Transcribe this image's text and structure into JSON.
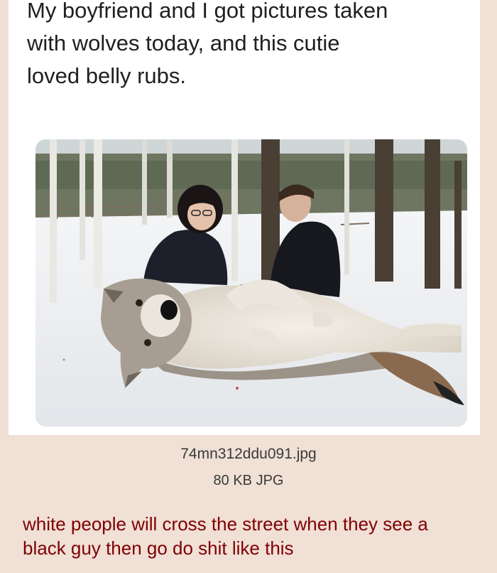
{
  "tweet": {
    "text": "My boyfriend and I got pictures taken\nwith wolves today, and this cutie\nloved belly rubs."
  },
  "attachment": {
    "filename": "74mn312ddu091.jpg",
    "size_type": "80 KB JPG"
  },
  "comment": {
    "text": "white people will cross the street when they see a\nblack guy then go do shit like this"
  },
  "colors": {
    "page_background": "#f0e0d6",
    "comment_text": "#800000",
    "tweet_background": "#ffffff"
  }
}
